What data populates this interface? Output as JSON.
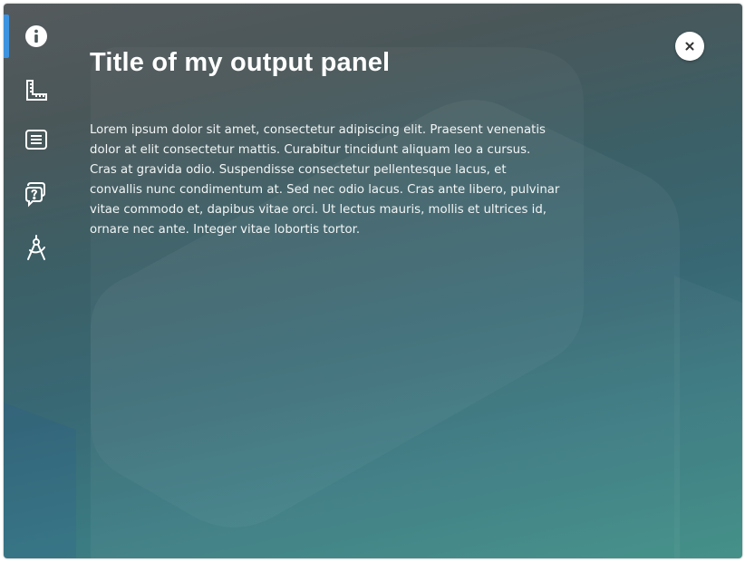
{
  "panel": {
    "title": "Title of my output panel",
    "body": "Lorem ipsum dolor sit amet, consectetur adipiscing elit. Praesent venenatis dolor at elit consectetur mattis. Curabitur tincidunt aliquam leo a cursus. Cras at gravida odio. Suspendisse consectetur pellentesque lacus, et convallis nunc condimentum at. Sed nec odio lacus. Cras ante libero, pulvinar vitae commodo et, dapibus vitae orci. Ut lectus mauris, mollis et ultrices id, ornare nec ante. Integer vitae lobortis tortor."
  },
  "sidebar": {
    "items": [
      {
        "icon": "info-icon",
        "active": true
      },
      {
        "icon": "ruler-icon",
        "active": false
      },
      {
        "icon": "document-list-icon",
        "active": false
      },
      {
        "icon": "question-chat-icon",
        "active": false
      },
      {
        "icon": "compass-tool-icon",
        "active": false
      }
    ]
  },
  "close_button": {
    "icon": "close-icon"
  },
  "colors": {
    "accent": "#3d93e0",
    "gradient_top": "#555a5d",
    "gradient_bottom": "#3f8e86",
    "text": "#ffffff"
  }
}
